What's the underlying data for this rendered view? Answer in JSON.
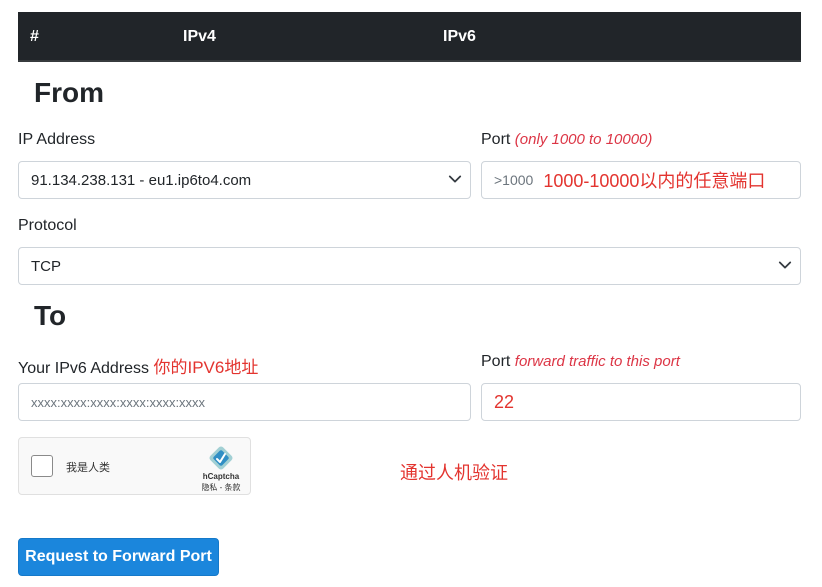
{
  "table": {
    "col_num": "#",
    "col_ipv4": "IPv4",
    "col_ipv6": "IPv6"
  },
  "from": {
    "heading": "From",
    "ip_label": "IP Address",
    "ip_value": "91.134.238.131 - eu1.ip6to4.com",
    "port_label": "Port",
    "port_hint": "(only 1000 to 10000)",
    "port_placeholder": ">1000",
    "port_annotation": "1000-10000以内的任意端口",
    "protocol_label": "Protocol",
    "protocol_value": "TCP"
  },
  "to": {
    "heading": "To",
    "ipv6_label": "Your IPv6 Address",
    "ipv6_annotation": "你的IPV6地址",
    "ipv6_placeholder": "xxxx:xxxx:xxxx:xxxx:xxxx:xxxx",
    "port_label": "Port",
    "port_hint": "forward traffic to this port",
    "port_value": "22"
  },
  "captcha": {
    "checkbox_text": "我是人类",
    "brand": "hCaptcha",
    "terms": "隐私 - 条款",
    "annotation": "通过人机验证"
  },
  "submit_label": "Request to Forward Port",
  "colors": {
    "header_bg": "#212529",
    "annotation_red": "#e3342f",
    "button_blue": "#1b86dc"
  }
}
